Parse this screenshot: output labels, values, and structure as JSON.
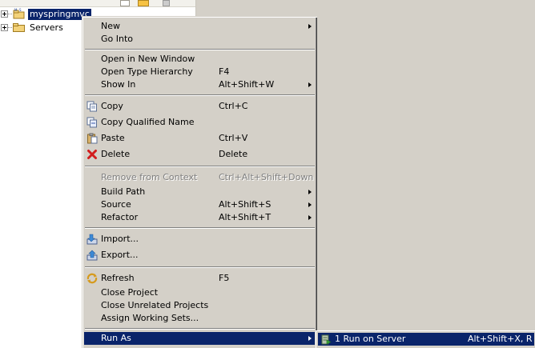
{
  "explorer": {
    "items": [
      {
        "label": "myspringmvc",
        "selected": true
      },
      {
        "label": "Servers",
        "selected": false
      }
    ]
  },
  "context_menu": {
    "items": [
      {
        "label": "New",
        "submenu": true
      },
      {
        "label": "Go Into"
      },
      {
        "label": "Open in New Window"
      },
      {
        "label": "Open Type Hierarchy",
        "shortcut": "F4"
      },
      {
        "label": "Show In",
        "shortcut": "Alt+Shift+W",
        "submenu": true
      },
      {
        "label": "Copy",
        "shortcut": "Ctrl+C",
        "icon": "copy-icon"
      },
      {
        "label": "Copy Qualified Name",
        "icon": "copy-qualified-name-icon"
      },
      {
        "label": "Paste",
        "shortcut": "Ctrl+V",
        "icon": "paste-icon"
      },
      {
        "label": "Delete",
        "shortcut": "Delete",
        "icon": "delete-icon"
      },
      {
        "label": "Remove from Context",
        "shortcut": "Ctrl+Alt+Shift+Down",
        "disabled": true
      },
      {
        "label": "Build Path",
        "submenu": true
      },
      {
        "label": "Source",
        "shortcut": "Alt+Shift+S",
        "submenu": true
      },
      {
        "label": "Refactor",
        "shortcut": "Alt+Shift+T",
        "submenu": true
      },
      {
        "label": "Import...",
        "icon": "import-icon"
      },
      {
        "label": "Export...",
        "icon": "export-icon"
      },
      {
        "label": "Refresh",
        "shortcut": "F5",
        "icon": "refresh-icon"
      },
      {
        "label": "Close Project"
      },
      {
        "label": "Close Unrelated Projects"
      },
      {
        "label": "Assign Working Sets..."
      },
      {
        "label": "Run As",
        "submenu": true,
        "highlighted": true
      }
    ]
  },
  "run_as_submenu": {
    "items": [
      {
        "label": "1 Run on Server",
        "shortcut": "Alt+Shift+X, R",
        "icon": "server-run-icon"
      }
    ]
  },
  "colors": {
    "selection": "#0a246a",
    "menu_bg": "#d4d0c8",
    "disabled_text": "#808080"
  }
}
